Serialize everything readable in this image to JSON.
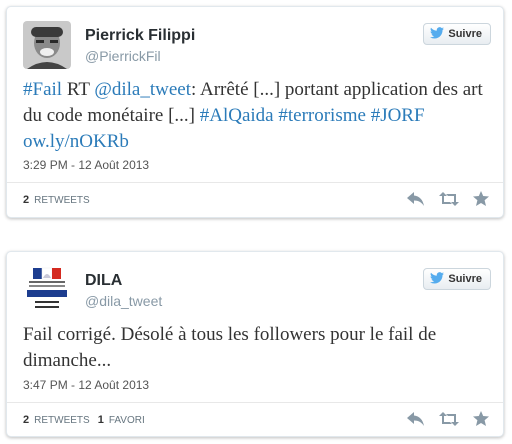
{
  "tweets": [
    {
      "name": "Pierrick Filippi",
      "handle": "@PierrickFil",
      "follow_label": "Suivre",
      "text_parts": [
        {
          "t": "#Fail",
          "link": true
        },
        {
          "t": " RT ",
          "link": false
        },
        {
          "t": "@dila_tweet",
          "link": true
        },
        {
          "t": ": Arrêté [...] portant application des art  du code monétaire [...] ",
          "link": false
        },
        {
          "t": "#AlQaida",
          "link": true
        },
        {
          "t": " ",
          "link": false
        },
        {
          "t": "#terrorisme",
          "link": true
        },
        {
          "t": "  ",
          "link": false
        },
        {
          "t": "#JORF",
          "link": true
        },
        {
          "t": " ",
          "link": false
        },
        {
          "t": "ow.ly/nOKRb",
          "link": true
        }
      ],
      "timestamp": "3:29 PM - 12 Août 2013",
      "retweets_count": "2",
      "retweets_label": "RETWEETS"
    },
    {
      "name": "DILA",
      "handle": "@dila_tweet",
      "follow_label": "Suivre",
      "text": "Fail corrigé. Désolé à tous les followers pour le fail de dimanche...",
      "timestamp": "3:47 PM - 12 Août 2013",
      "retweets_count": "2",
      "retweets_label": "RETWEETS",
      "favorites_count": "1",
      "favorites_label": "FAVORI",
      "logo_text": {
        "motto": "Liberté • Égalité • Fraternité",
        "republic": "RÉPUBLIQUE FRANÇAISE",
        "ministry": "Premier ministre",
        "direction": "Direction de l'information"
      }
    }
  ],
  "colors": {
    "link": "#2b7bb9",
    "twitter_bird": "#55acee",
    "action_icon": "#8899a6"
  }
}
